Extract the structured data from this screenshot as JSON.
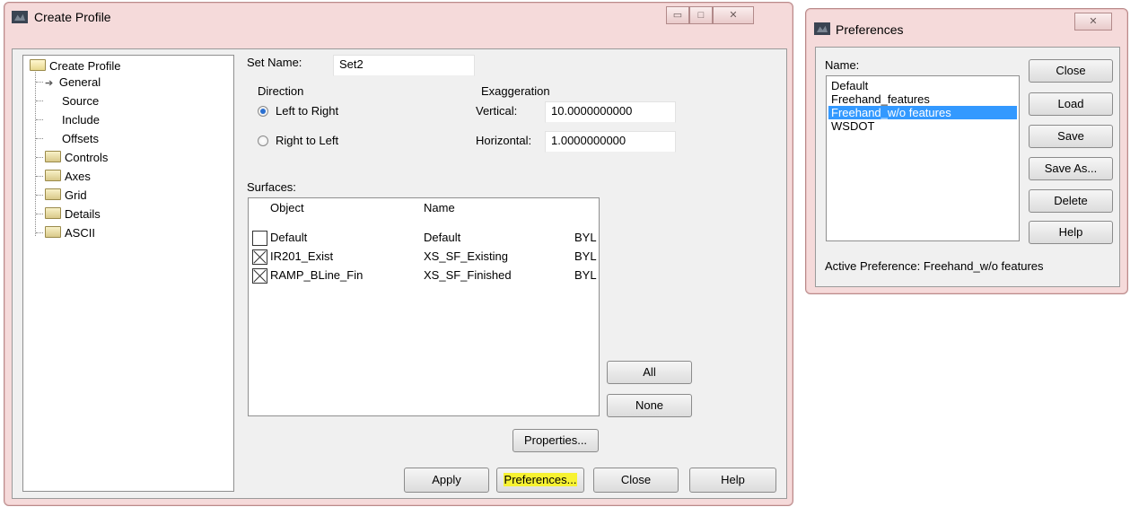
{
  "create_profile": {
    "title": "Create Profile",
    "caption_buttons": {
      "minimize": "▭",
      "maximize": "□",
      "close": "✕"
    },
    "tree": {
      "root": "Create Profile",
      "items": [
        "General",
        "Source",
        "Include",
        "Offsets",
        "Controls",
        "Axes",
        "Grid",
        "Details",
        "ASCII"
      ],
      "selected": "General"
    },
    "set_name_label": "Set Name:",
    "set_name_value": "Set2",
    "direction_label": "Direction",
    "left_to_right": "Left to Right",
    "right_to_left": "Right to Left",
    "exaggeration_label": "Exaggeration",
    "vertical_label": "Vertical:",
    "vertical_value": "10.0000000000",
    "horizontal_label": "Horizontal:",
    "horizontal_value": "1.0000000000",
    "surfaces_label": "Surfaces:",
    "surfaces": {
      "headers": [
        "Object",
        "Name"
      ],
      "rows": [
        {
          "checked": false,
          "object": "Default",
          "name": "Default",
          "extra": "BYL"
        },
        {
          "checked": true,
          "object": "IR201_Exist",
          "name": "XS_SF_Existing",
          "extra": "BYL"
        },
        {
          "checked": true,
          "object": "RAMP_BLine_Fin",
          "name": "XS_SF_Finished",
          "extra": "BYL"
        }
      ]
    },
    "all_button": "All",
    "none_button": "None",
    "properties_button": "Properties...",
    "apply_button": "Apply",
    "preferences_button": "Preferences...",
    "close_button": "Close",
    "help_button": "Help"
  },
  "preferences": {
    "title": "Preferences",
    "close_x": "✕",
    "name_label": "Name:",
    "items": [
      "Default",
      "Freehand_features",
      "Freehand_w/o features",
      "WSDOT"
    ],
    "selected_index": 2,
    "buttons": [
      "Close",
      "Load",
      "Save",
      "Save As...",
      "Delete",
      "Help"
    ],
    "active_preference": "Active Preference: Freehand_w/o features"
  },
  "colors": {
    "frame": "#f5dada",
    "selection": "#3399ff",
    "highlight": "#f7f232"
  }
}
